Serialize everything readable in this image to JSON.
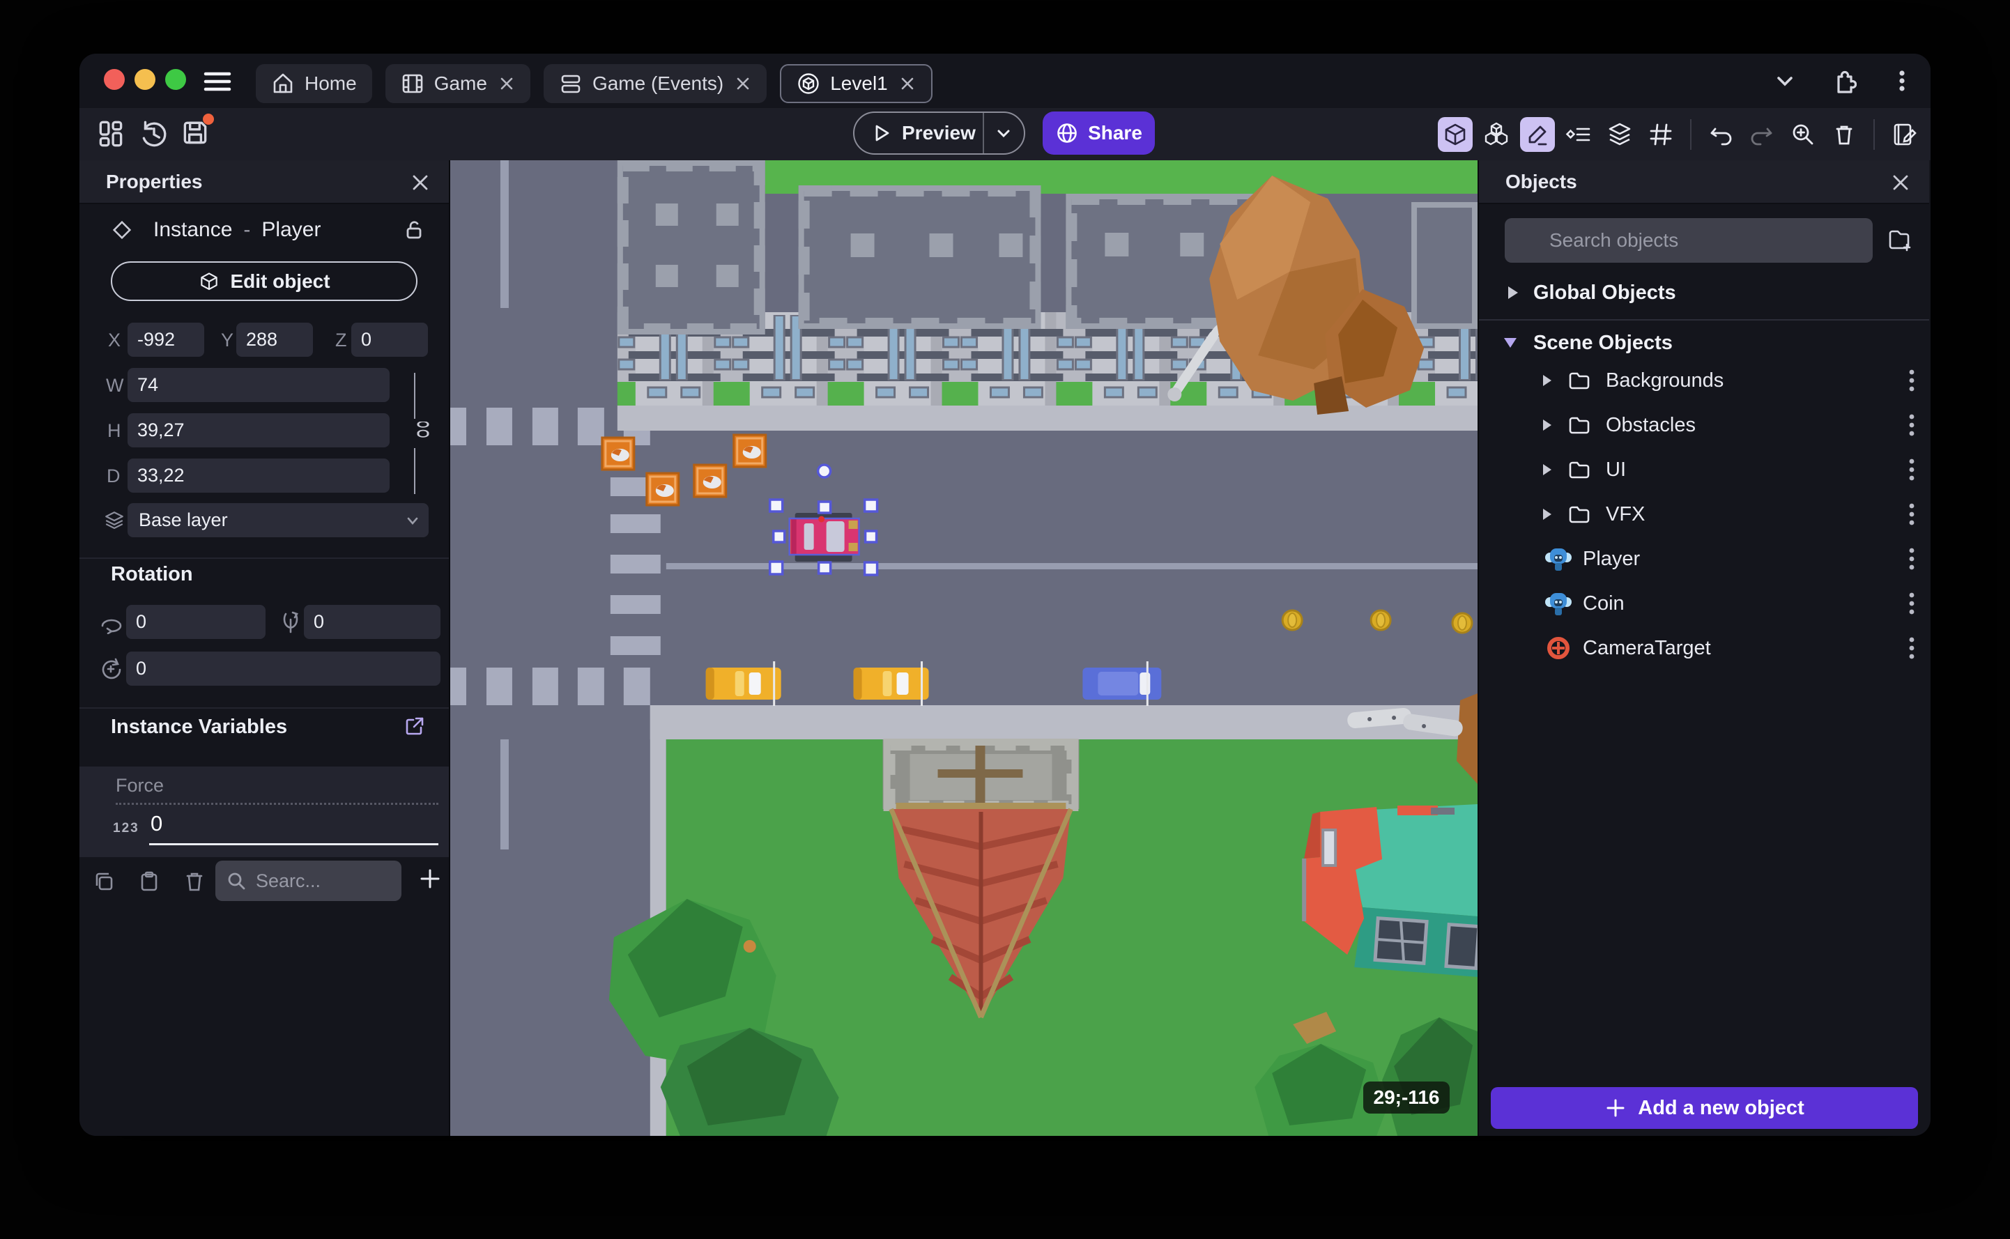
{
  "window": {
    "tabs": [
      {
        "label": "Home"
      },
      {
        "label": "Game"
      },
      {
        "label": "Game (Events)"
      },
      {
        "label": "Level1"
      }
    ]
  },
  "toolbar": {
    "preview_label": "Preview",
    "share_label": "Share"
  },
  "properties": {
    "title": "Properties",
    "instance_label": "Instance",
    "separator": "-",
    "object_name": "Player",
    "edit_object_label": "Edit object",
    "x_label": "X",
    "x_value": "-992",
    "y_label": "Y",
    "y_value": "288",
    "z_label": "Z",
    "z_value": "0",
    "w_label": "W",
    "w_value": "74",
    "h_label": "H",
    "h_value": "39,27",
    "d_label": "D",
    "d_value": "33,22",
    "layer_value": "Base layer",
    "rotation_title": "Rotation",
    "rotation_x": "0",
    "rotation_y": "0",
    "rotation_z": "0",
    "variables_title": "Instance Variables",
    "variable_name": "Force",
    "variable_type_badge": "123",
    "variable_value": "0",
    "search_placeholder": "Searc..."
  },
  "objects": {
    "title": "Objects",
    "search_placeholder": "Search objects",
    "global_group_label": "Global Objects",
    "scene_group_label": "Scene Objects",
    "items": [
      {
        "label": "Backgrounds",
        "type": "folder"
      },
      {
        "label": "Obstacles",
        "type": "folder"
      },
      {
        "label": "UI",
        "type": "folder"
      },
      {
        "label": "VFX",
        "type": "folder"
      },
      {
        "label": "Player",
        "type": "object"
      },
      {
        "label": "Coin",
        "type": "object"
      },
      {
        "label": "CameraTarget",
        "type": "camera"
      }
    ],
    "add_button_label": "Add a new object"
  },
  "scene": {
    "coordinate_badge": "29;-116"
  },
  "colors": {
    "accent": "#5b31d6",
    "toolbar_active": "#cdc2f3",
    "selection": "#5558d8",
    "unsaved_badge": "#f0623d"
  }
}
